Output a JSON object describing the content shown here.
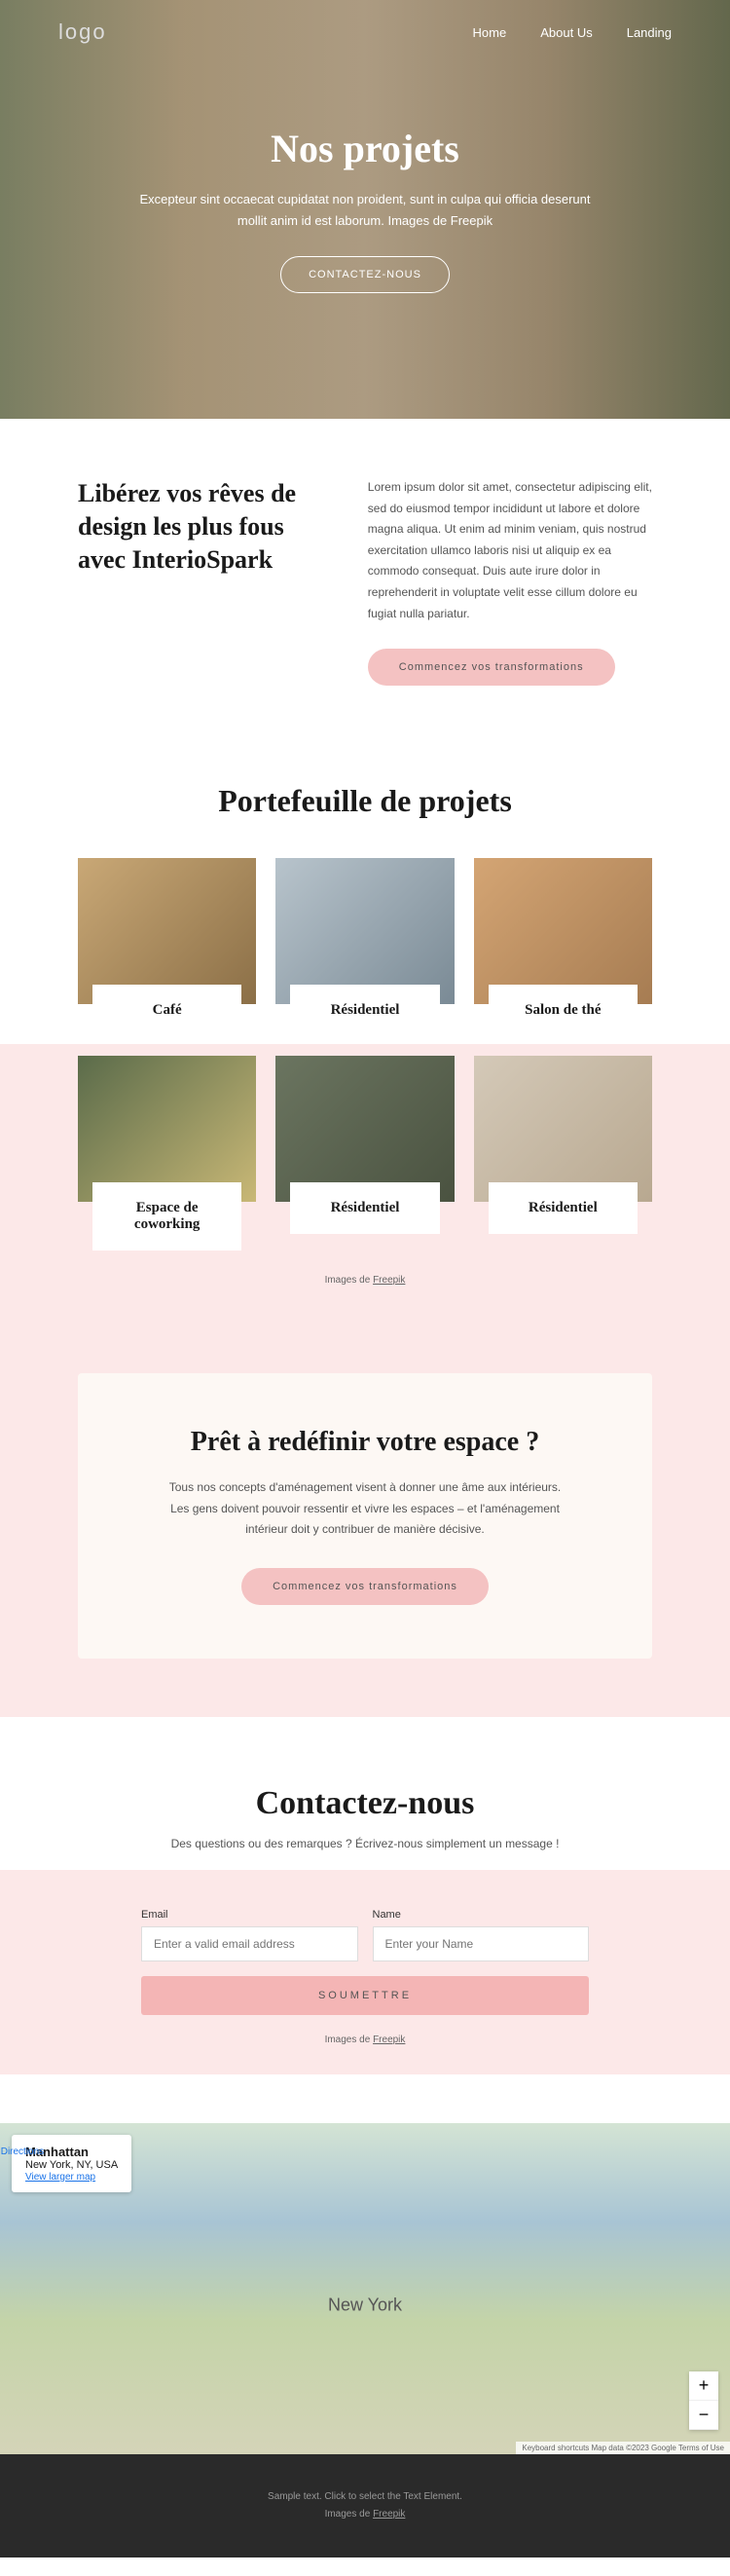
{
  "nav": {
    "logo": "logo",
    "home": "Home",
    "about": "About Us",
    "landing": "Landing"
  },
  "hero": {
    "title": "Nos projets",
    "text": "Excepteur sint occaecat cupidatat non proident, sunt in culpa qui officia deserunt mollit anim id est laborum. Images de Freepik",
    "btn": "CONTACTEZ-NOUS"
  },
  "intro": {
    "title": "Libérez vos rêves de design les plus fous avec InterioSpark",
    "text": "Lorem ipsum dolor sit amet, consectetur adipiscing elit, sed do eiusmod tempor incididunt ut labore et dolore magna aliqua. Ut enim ad minim veniam, quis nostrud exercitation ullamco laboris nisi ut aliquip ex ea commodo consequat. Duis aute irure dolor in reprehenderit in voluptate velit esse cillum dolore eu fugiat nulla pariatur.",
    "btn": "Commencez vos transformations"
  },
  "portfolio": {
    "title": "Portefeuille de projets",
    "items": [
      "Café",
      "Résidentiel",
      "Salon de thé",
      "Espace de coworking",
      "Résidentiel",
      "Résidentiel"
    ],
    "credit_prefix": "Images de ",
    "credit_link": "Freepik"
  },
  "cta": {
    "title": "Prêt à redéfinir votre espace ?",
    "text": "Tous nos concepts d'aménagement visent à donner une âme aux intérieurs. Les gens doivent pouvoir ressentir et vivre les espaces – et l'aménagement intérieur doit y contribuer de manière décisive.",
    "btn": "Commencez vos transformations"
  },
  "contact": {
    "title": "Contactez-nous",
    "sub": "Des questions ou des remarques ? Écrivez-nous simplement un message !",
    "email_label": "Email",
    "email_ph": "Enter a valid email address",
    "name_label": "Name",
    "name_ph": "Enter your Name",
    "submit": "SOUMETTRE",
    "credit_prefix": "Images de ",
    "credit_link": "Freepik"
  },
  "map": {
    "place": "Manhattan",
    "addr": "New York, NY, USA",
    "view": "View larger map",
    "dir": "Directions",
    "city": "New York",
    "attr": "Keyboard shortcuts   Map data ©2023 Google   Terms of Use"
  },
  "footer": {
    "l1": "Sample text. Click to select the Text Element.",
    "l2_prefix": "Images de ",
    "l2_link": "Freepik"
  }
}
